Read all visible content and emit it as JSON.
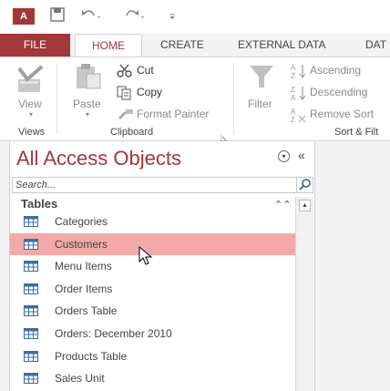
{
  "quick_access": {
    "app_icon_text": "A",
    "icons": [
      "save-icon",
      "undo-icon",
      "redo-icon",
      "customize-icon"
    ]
  },
  "tabs": [
    {
      "label": "FILE"
    },
    {
      "label": "HOME"
    },
    {
      "label": "CREATE"
    },
    {
      "label": "EXTERNAL DATA"
    },
    {
      "label": "DAT"
    }
  ],
  "ribbon": {
    "views": {
      "view": "View",
      "group": "Views"
    },
    "clipboard": {
      "paste": "Paste",
      "cut": "Cut",
      "copy": "Copy",
      "format_painter": "Format Painter",
      "group": "Clipboard"
    },
    "sort_filter": {
      "filter": "Filter",
      "ascending": "Ascending",
      "descending": "Descending",
      "remove_sort": "Remove Sort",
      "group": "Sort & Filt"
    }
  },
  "nav_pane": {
    "title": "All Access Objects",
    "search_placeholder": "Search...",
    "group_header": "Tables",
    "items": [
      {
        "label": "Categories",
        "selected": false
      },
      {
        "label": "Customers",
        "selected": true
      },
      {
        "label": "Menu Items",
        "selected": false
      },
      {
        "label": "Order Items",
        "selected": false
      },
      {
        "label": "Orders Table",
        "selected": false
      },
      {
        "label": "Orders: December 2010",
        "selected": false
      },
      {
        "label": "Products Table",
        "selected": false
      },
      {
        "label": "Sales Unit",
        "selected": false
      }
    ]
  },
  "colors": {
    "accent": "#a4373a",
    "selection": "#f4a9a9"
  }
}
